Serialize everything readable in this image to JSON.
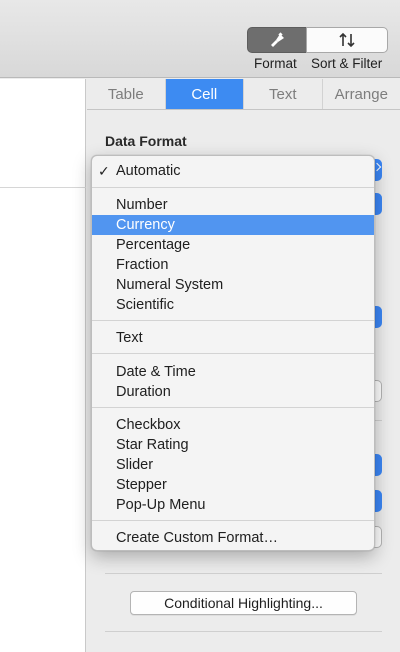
{
  "toolbar": {
    "format_label": "Format",
    "sort_filter_label": "Sort & Filter"
  },
  "inspector": {
    "tabs": [
      {
        "label": "Table"
      },
      {
        "label": "Cell"
      },
      {
        "label": "Text"
      },
      {
        "label": "Arrange"
      }
    ],
    "active_tab": "Cell",
    "section_title": "Data Format"
  },
  "menu": {
    "checked": "Automatic",
    "highlighted": "Currency",
    "items": [
      "Automatic",
      "Number",
      "Currency",
      "Percentage",
      "Fraction",
      "Numeral System",
      "Scientific",
      "Text",
      "Date & Time",
      "Duration",
      "Checkbox",
      "Star Rating",
      "Slider",
      "Stepper",
      "Pop-Up Menu",
      "Create Custom Format…"
    ]
  },
  "buttons": {
    "conditional_highlighting": "Conditional Highlighting..."
  },
  "colors": {
    "accent": "#3d8bf2",
    "menu_highlight": "#5195f0"
  }
}
